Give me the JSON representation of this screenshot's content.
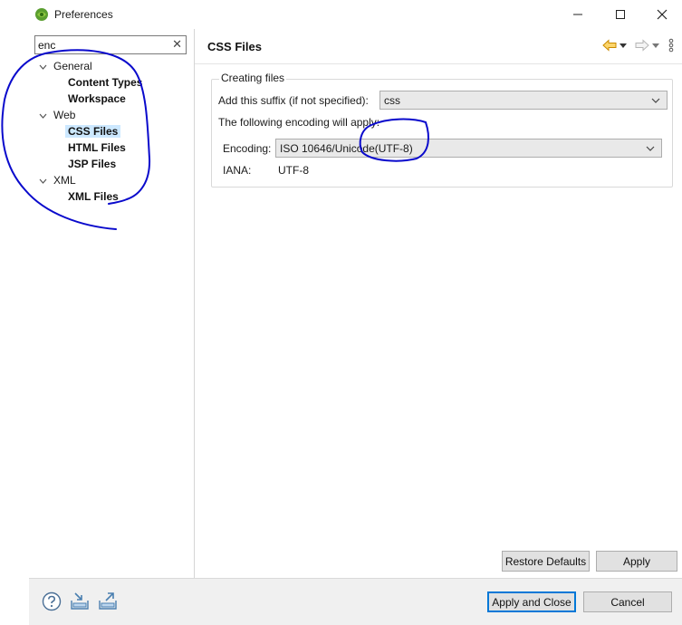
{
  "window": {
    "title": "Preferences",
    "controls": {
      "minimize": "—",
      "maximize": "☐",
      "close": "✕"
    }
  },
  "filter": {
    "value": "enc",
    "clear_icon": "✕"
  },
  "tree": [
    {
      "label": "General",
      "expanded": true,
      "children": [
        {
          "label": "Content Types"
        },
        {
          "label": "Workspace"
        }
      ]
    },
    {
      "label": "Web",
      "expanded": true,
      "children": [
        {
          "label": "CSS Files",
          "selected": true
        },
        {
          "label": "HTML Files"
        },
        {
          "label": "JSP Files"
        }
      ]
    },
    {
      "label": "XML",
      "expanded": true,
      "children": [
        {
          "label": "XML Files"
        }
      ]
    }
  ],
  "page": {
    "title": "CSS Files",
    "nav": {
      "back_icon": "arrow-left-icon",
      "forward_icon": "arrow-right-icon",
      "menu_icon": "view-menu-icon"
    },
    "group": {
      "title": "Creating files",
      "suffix_label": "Add this suffix (if not specified):",
      "suffix_value": "css",
      "encoding_note": "The following encoding will apply:",
      "encoding_label": "Encoding:",
      "encoding_value": "ISO 10646/Unicode(UTF-8)",
      "iana_label": "IANA:",
      "iana_value": "UTF-8"
    },
    "restore_defaults_label": "Restore Defaults",
    "apply_label": "Apply"
  },
  "footer": {
    "help_icon": "help-icon",
    "import_icon": "import-icon",
    "export_icon": "export-icon",
    "apply_close_label": "Apply and Close",
    "cancel_label": "Cancel"
  },
  "colors": {
    "selection": "#cce8ff",
    "accent": "#0078d7",
    "annotation": "#0000cc",
    "nav_back": "#e8a317"
  }
}
